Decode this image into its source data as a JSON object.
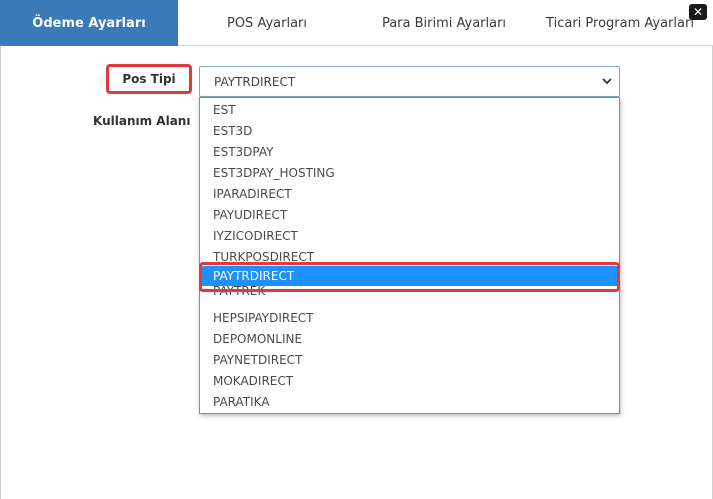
{
  "tabs": [
    {
      "label": "Ödeme Ayarları",
      "active": true
    },
    {
      "label": "POS Ayarları",
      "active": false
    },
    {
      "label": "Para Birimi Ayarları",
      "active": false
    },
    {
      "label": "Ticari Program Ayarları",
      "active": false
    }
  ],
  "close": {
    "glyph": "✕"
  },
  "form": {
    "pos_type_label": "Pos Tipi",
    "usage_area_label": "Kullanım Alanı",
    "selected_value": "PAYTRDIRECT"
  },
  "dropdown": {
    "options": [
      "EST",
      "EST3D",
      "EST3DPAY",
      "EST3DPAY_HOSTING",
      "IPARADIRECT",
      "PAYUDIRECT",
      "IYZICODIRECT",
      "TURKPOSDIRECT",
      "PAYTRDIRECT",
      "PAYTREK",
      "HEPSIPAYDIRECT",
      "DEPOMONLINE",
      "PAYNETDIRECT",
      "MOKADIRECT",
      "PARATIKA"
    ],
    "highlighted_index": 8
  },
  "colors": {
    "accent": "#3a7ab8",
    "highlight": "#1e90ff",
    "annotation": "#e03a3a"
  }
}
